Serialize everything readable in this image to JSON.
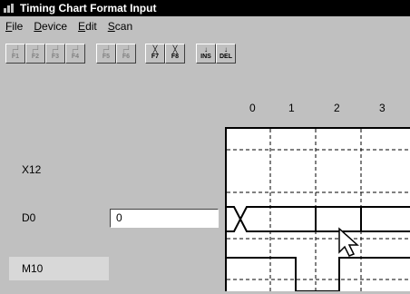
{
  "window": {
    "title": "Timing Chart Format Input"
  },
  "menu": [
    {
      "label": "File",
      "key": "F"
    },
    {
      "label": "Device",
      "key": "D"
    },
    {
      "label": "Edit",
      "key": "E"
    },
    {
      "label": "Scan",
      "key": "S"
    }
  ],
  "toolbar": {
    "buttons": [
      {
        "name": "f1-button",
        "key": "F1",
        "enabled": false
      },
      {
        "name": "f2-button",
        "key": "F2",
        "enabled": false
      },
      {
        "name": "f3-button",
        "key": "F3",
        "enabled": false
      },
      {
        "name": "f4-button",
        "key": "F4",
        "enabled": false
      },
      {
        "name": "f5-button",
        "key": "F5",
        "enabled": false
      },
      {
        "name": "f6-button",
        "key": "F6",
        "enabled": false
      },
      {
        "name": "f7-button",
        "key": "F7",
        "enabled": true
      },
      {
        "name": "f8-button",
        "key": "F8",
        "enabled": true
      },
      {
        "name": "ins-button",
        "key": "INS",
        "enabled": true
      },
      {
        "name": "del-button",
        "key": "DEL",
        "enabled": true
      }
    ]
  },
  "ruler": {
    "ticks": [
      "0",
      "1",
      "2",
      "3"
    ]
  },
  "signals": [
    {
      "label": "X12"
    },
    {
      "label": "D0",
      "value": "0"
    },
    {
      "label": "M10"
    }
  ]
}
